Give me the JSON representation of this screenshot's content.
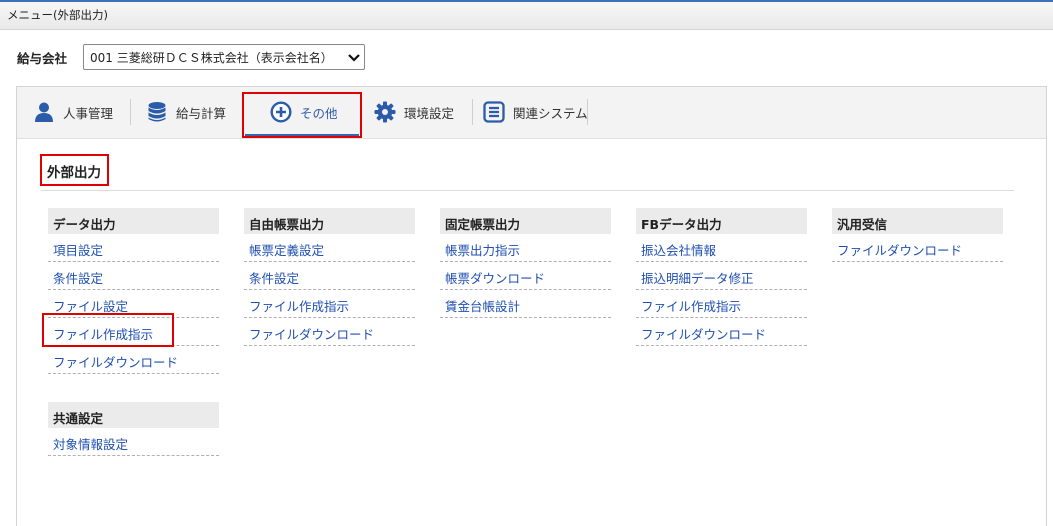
{
  "window": {
    "title": "メニュー(外部出力)"
  },
  "company": {
    "label": "給与会社",
    "selected": "001 三菱総研ＤＣＳ株式会社（表示会社名）"
  },
  "tabs": [
    {
      "label": "人事管理",
      "icon": "person-icon"
    },
    {
      "label": "給与計算",
      "icon": "database-icon"
    },
    {
      "label": "その他",
      "icon": "plus-circle-icon",
      "active": true
    },
    {
      "label": "環境設定",
      "icon": "gear-icon"
    },
    {
      "label": "関連システム",
      "icon": "list-icon"
    }
  ],
  "section": {
    "title": "外部出力"
  },
  "columns": [
    {
      "header": "データ出力",
      "items": [
        "項目設定",
        "条件設定",
        "ファイル設定",
        "ファイル作成指示",
        "ファイルダウンロード"
      ]
    },
    {
      "header": "自由帳票出力",
      "items": [
        "帳票定義設定",
        "条件設定",
        "ファイル作成指示",
        "ファイルダウンロード"
      ]
    },
    {
      "header": "固定帳票出力",
      "items": [
        "帳票出力指示",
        "帳票ダウンロード",
        "賃金台帳設計"
      ]
    },
    {
      "header": "FBデータ出力",
      "items": [
        "振込会社情報",
        "振込明細データ修正",
        "ファイル作成指示",
        "ファイルダウンロード"
      ]
    },
    {
      "header": "汎用受信",
      "items": [
        "ファイルダウンロード"
      ]
    },
    {
      "header": "共通設定",
      "items": [
        "対象情報設定"
      ]
    }
  ],
  "colors": {
    "accent": "#2f66b6",
    "link": "#1f4fb0",
    "highlight": "#e00000"
  }
}
